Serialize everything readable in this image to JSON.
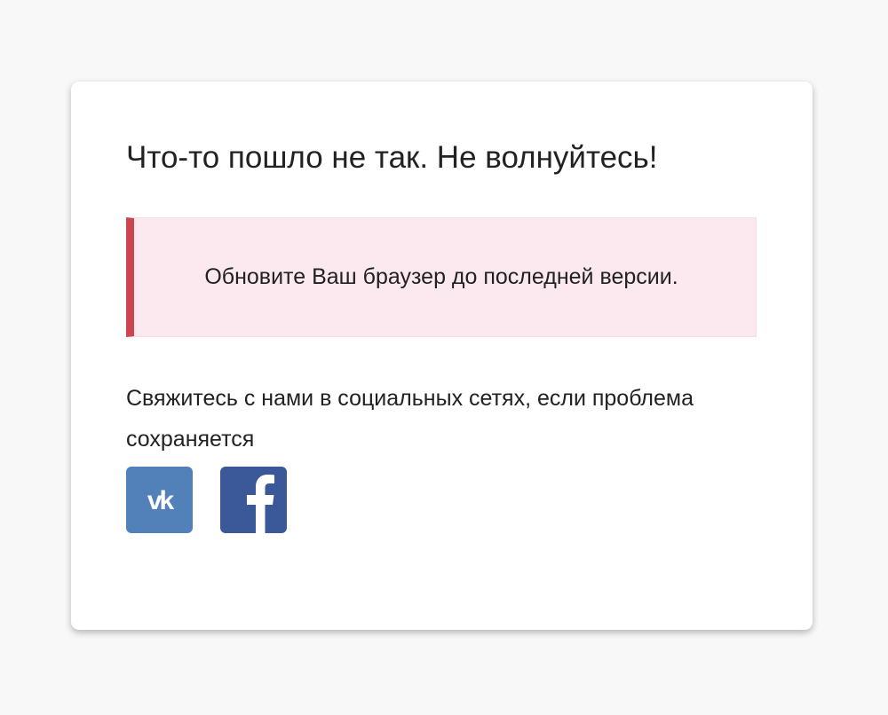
{
  "error": {
    "title": "Что-то пошло не так. Не волнуйтесь!",
    "alert_message": "Обновите Ваш браузер до последней версии.",
    "contact_text": "Свяжитесь с нами в социальных сетях, если проблема сохраняется"
  },
  "socials": [
    {
      "name": "vk",
      "icon": "vk-icon",
      "color": "#5181b8"
    },
    {
      "name": "facebook",
      "icon": "facebook-icon",
      "color": "#3b5998"
    }
  ],
  "colors": {
    "page_background": "#f8f8f8",
    "card_background": "#ffffff",
    "alert_background": "#fce9ef",
    "alert_accent": "#cc4650",
    "text": "#222222"
  }
}
